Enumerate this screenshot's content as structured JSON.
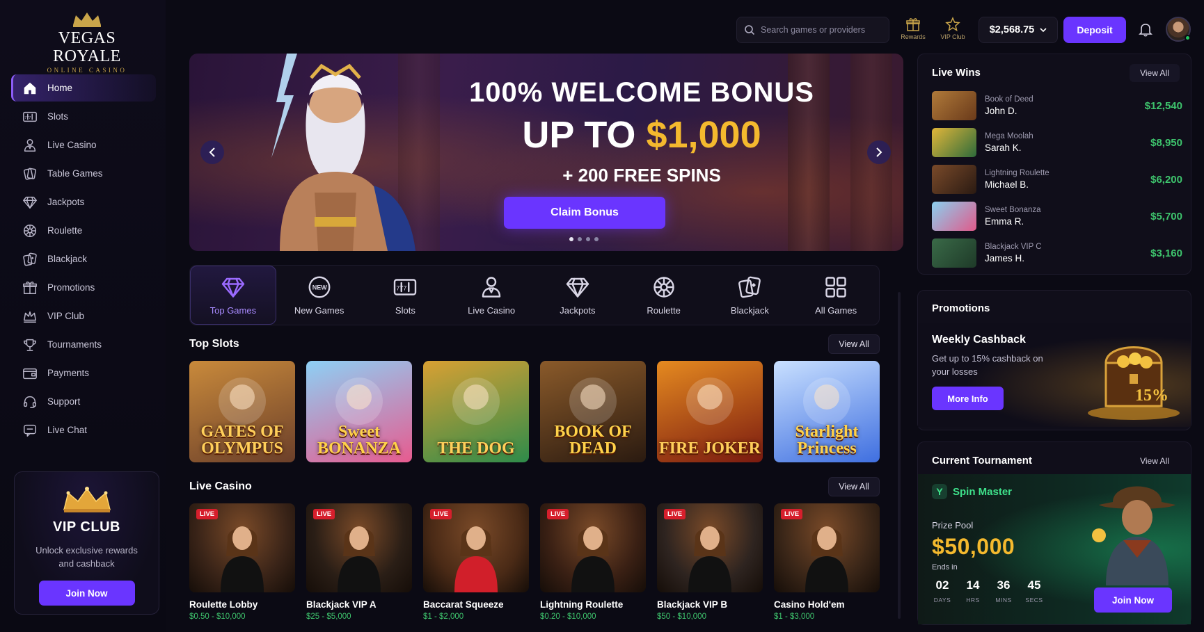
{
  "brand": {
    "name": "VEGAS ROYALE",
    "tagline": "ONLINE CASINO"
  },
  "sidebar": {
    "items": [
      {
        "label": "Home",
        "icon": "home-icon",
        "active": true
      },
      {
        "label": "Slots",
        "icon": "slot-machine-icon"
      },
      {
        "label": "Live Casino",
        "icon": "dealer-icon"
      },
      {
        "label": "Table Games",
        "icon": "cards-icon"
      },
      {
        "label": "Jackpots",
        "icon": "diamond-icon"
      },
      {
        "label": "Roulette",
        "icon": "roulette-icon"
      },
      {
        "label": "Blackjack",
        "icon": "playing-cards-icon"
      },
      {
        "label": "Promotions",
        "icon": "gift-icon"
      },
      {
        "label": "VIP Club",
        "icon": "crown-icon"
      },
      {
        "label": "Tournaments",
        "icon": "trophy-icon"
      },
      {
        "label": "Payments",
        "icon": "wallet-icon"
      },
      {
        "label": "Support",
        "icon": "headset-icon"
      },
      {
        "label": "Live Chat",
        "icon": "chat-icon"
      }
    ],
    "vip": {
      "title": "VIP CLUB",
      "description": "Unlock exclusive rewards and cashback",
      "button": "Join Now"
    }
  },
  "header": {
    "search_placeholder": "Search games or providers",
    "rewards_label": "Rewards",
    "vip_label": "VIP Club",
    "balance": "$2,568.75",
    "deposit": "Deposit"
  },
  "hero": {
    "line1": "100% WELCOME BONUS",
    "line2_prefix": "UP TO ",
    "line2_amount": "$1,000",
    "line3": "+ 200 FREE SPINS",
    "cta": "Claim Bonus",
    "slide_count": 4,
    "active_slide": 1
  },
  "categories": [
    {
      "label": "Top Games",
      "icon": "diamond-icon",
      "active": true
    },
    {
      "label": "New Games",
      "icon": "new-badge-icon"
    },
    {
      "label": "Slots",
      "icon": "slot-machine-icon"
    },
    {
      "label": "Live Casino",
      "icon": "dealer-icon"
    },
    {
      "label": "Jackpots",
      "icon": "diamond-icon"
    },
    {
      "label": "Roulette",
      "icon": "roulette-icon"
    },
    {
      "label": "Blackjack",
      "icon": "playing-cards-icon"
    },
    {
      "label": "All Games",
      "icon": "grid-icon"
    }
  ],
  "top_slots": {
    "title": "Top Slots",
    "view_all": "View All",
    "games": [
      {
        "name": "GATES OF OLYMPUS",
        "bg": [
          "#6b3f2a",
          "#c98a3b"
        ]
      },
      {
        "name": "Sweet BONANZA",
        "bg": [
          "#e75b8f",
          "#8dd0f5"
        ]
      },
      {
        "name": "THE DOG",
        "bg": [
          "#2e8b4a",
          "#d9a033"
        ]
      },
      {
        "name": "BOOK OF DEAD",
        "bg": [
          "#2a1a10",
          "#8a5a2a"
        ]
      },
      {
        "name": "FIRE JOKER",
        "bg": [
          "#7a1a10",
          "#e58a20"
        ]
      },
      {
        "name": "Starlight Princess",
        "bg": [
          "#3f6fe0",
          "#c9e0ff"
        ]
      }
    ]
  },
  "live_casino": {
    "title": "Live Casino",
    "view_all": "View All",
    "badge": "LIVE",
    "tables": [
      {
        "name": "Roulette Lobby",
        "range": "$0.50 - $10,000",
        "dress": "#111111",
        "bg": "#3a2418"
      },
      {
        "name": "Blackjack VIP A",
        "range": "$25 - $5,000",
        "dress": "#111111",
        "bg": "#2a1e16"
      },
      {
        "name": "Baccarat Squeeze",
        "range": "$1 - $2,000",
        "dress": "#d11f2a",
        "bg": "#4a2a16"
      },
      {
        "name": "Lightning Roulette",
        "range": "$0.20 - $10,000",
        "dress": "#111111",
        "bg": "#3a2014"
      },
      {
        "name": "Blackjack VIP B",
        "range": "$50 - $10,000",
        "dress": "#111111",
        "bg": "#2e2420"
      },
      {
        "name": "Casino Hold'em",
        "range": "$1 - $3,000",
        "dress": "#111111",
        "bg": "#3a2618"
      }
    ]
  },
  "live_wins": {
    "title": "Live Wins",
    "view_all": "View All",
    "items": [
      {
        "game": "Book of Deed",
        "user": "John D.",
        "amount": "$12,540",
        "thumb": [
          "#6a3a1a",
          "#b07a3a"
        ]
      },
      {
        "game": "Mega Moolah",
        "user": "Sarah K.",
        "amount": "$8,950",
        "thumb": [
          "#2d6b3a",
          "#e2b63a"
        ]
      },
      {
        "game": "Lightning Roulette",
        "user": "Michael B.",
        "amount": "$6,200",
        "thumb": [
          "#2a1a12",
          "#7a4a2a"
        ]
      },
      {
        "game": "Sweet Bonanza",
        "user": "Emma R.",
        "amount": "$5,700",
        "thumb": [
          "#e05a8a",
          "#8ad0f0"
        ]
      },
      {
        "game": "Blackjack VIP C",
        "user": "James H.",
        "amount": "$3,160",
        "thumb": [
          "#1e3a28",
          "#3a6a48"
        ]
      }
    ]
  },
  "promotions": {
    "title": "Promotions",
    "card_title": "Weekly Cashback",
    "card_desc": "Get up to 15% cashback on your losses",
    "button": "More Info",
    "chest_label": "15%"
  },
  "tournament": {
    "title": "Current Tournament",
    "view_all": "View All",
    "name": "Spin Master",
    "logo_letter": "Y",
    "prize_label": "Prize Pool",
    "prize": "$50,000",
    "ends_text": "Ends in",
    "countdown": [
      {
        "value": "02",
        "label": "DAYS"
      },
      {
        "value": "14",
        "label": "HRS"
      },
      {
        "value": "36",
        "label": "MINS"
      },
      {
        "value": "45",
        "label": "SECS"
      }
    ],
    "button": "Join Now"
  },
  "colors": {
    "accent": "#6a35ff",
    "gold": "#f4b92e",
    "win_green": "#3ec46d"
  }
}
